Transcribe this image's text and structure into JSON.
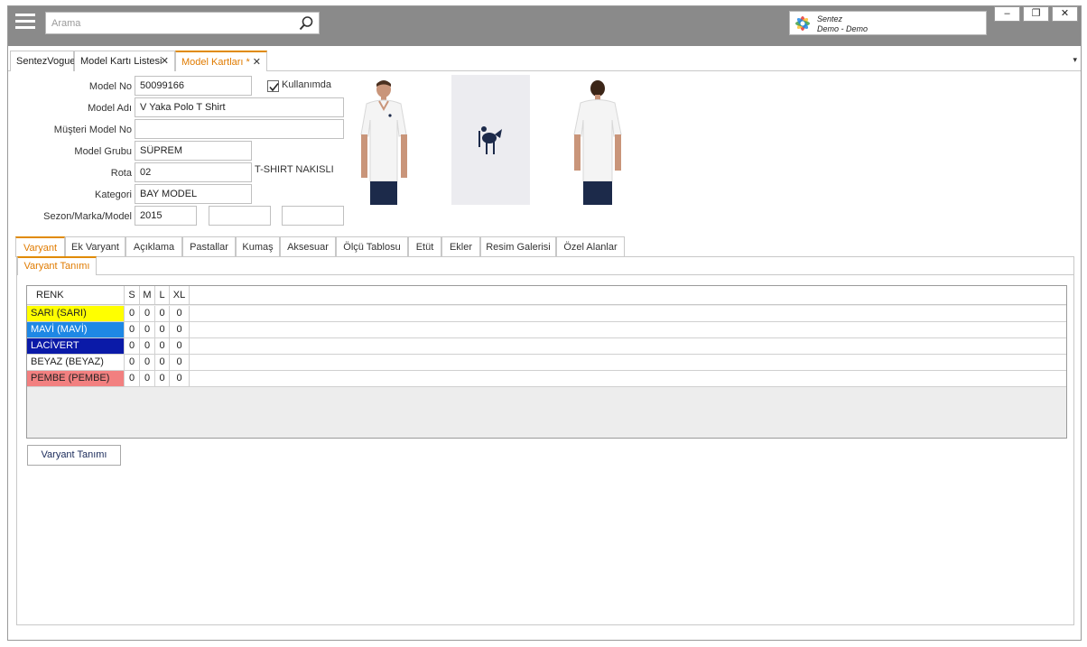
{
  "topbar": {
    "search_placeholder": "Arama",
    "company": {
      "name": "Sentez",
      "database": "Demo - Demo"
    },
    "window_buttons": {
      "minimize": "–",
      "restore": "❐",
      "close": "✕"
    }
  },
  "doc_tabs": [
    {
      "label": "SentezVogue",
      "closable": false
    },
    {
      "label": "Model Kartı Listesi",
      "closable": true
    },
    {
      "label": "Model Kartları *",
      "closable": true,
      "active": true
    }
  ],
  "doc_tab_close": "✕",
  "doc_tab_menu": "▾",
  "form": {
    "model_no": {
      "label": "Model No",
      "value": "50099166"
    },
    "in_use": {
      "label": "Kullanımda",
      "checked": true
    },
    "model_adi": {
      "label": "Model Adı",
      "value": "V Yaka Polo T Shirt"
    },
    "musteri_model_no": {
      "label": "Müşteri Model No",
      "value": ""
    },
    "model_grubu": {
      "label": "Model Grubu",
      "value": "SÜPREM"
    },
    "rota": {
      "label": "Rota",
      "value": "02",
      "description": "T-SHIRT NAKISLI"
    },
    "kategori": {
      "label": "Kategori",
      "value": "BAY MODEL"
    },
    "sezon_marka_model": {
      "label": "Sezon/Marka/Model",
      "sezon": "2015",
      "marka": "",
      "model": ""
    }
  },
  "tabs": [
    {
      "label": "Varyant",
      "active": true
    },
    {
      "label": "Ek Varyant"
    },
    {
      "label": "Açıklama"
    },
    {
      "label": "Pastallar"
    },
    {
      "label": "Kumaş"
    },
    {
      "label": "Aksesuar"
    },
    {
      "label": "Ölçü Tablosu"
    },
    {
      "label": "Etüt"
    },
    {
      "label": "Ekler"
    },
    {
      "label": "Resim Galerisi"
    },
    {
      "label": "Özel Alanlar"
    }
  ],
  "subtab": {
    "label": "Varyant Tanımı"
  },
  "grid": {
    "columns": [
      "RENK",
      "S",
      "M",
      "L",
      "XL"
    ],
    "rows": [
      {
        "renk": "SARI (SARI)",
        "bg": "#ffff00",
        "fg": "#222222",
        "values": [
          "0",
          "0",
          "0",
          "0"
        ]
      },
      {
        "renk": "MAVİ (MAVİ)",
        "bg": "#1e88e5",
        "fg": "#ffffff",
        "values": [
          "0",
          "0",
          "0",
          "0"
        ]
      },
      {
        "renk": "LACİVERT (LACİVERT)",
        "bg": "#0a1aa8",
        "fg": "#ffffff",
        "values": [
          "0",
          "0",
          "0",
          "0"
        ]
      },
      {
        "renk": "BEYAZ (BEYAZ)",
        "bg": "#ffffff",
        "fg": "#222222",
        "values": [
          "0",
          "0",
          "0",
          "0"
        ]
      },
      {
        "renk": "PEMBE (PEMBE)",
        "bg": "#f28080",
        "fg": "#222222",
        "values": [
          "0",
          "0",
          "0",
          "0"
        ]
      }
    ]
  },
  "buttons": {
    "varyant_tanimi": "Varyant Tanımı"
  },
  "colors": {
    "accent": "#e08a00",
    "topbar": "#8a8a8a",
    "button_text": "#1a2a5a"
  }
}
